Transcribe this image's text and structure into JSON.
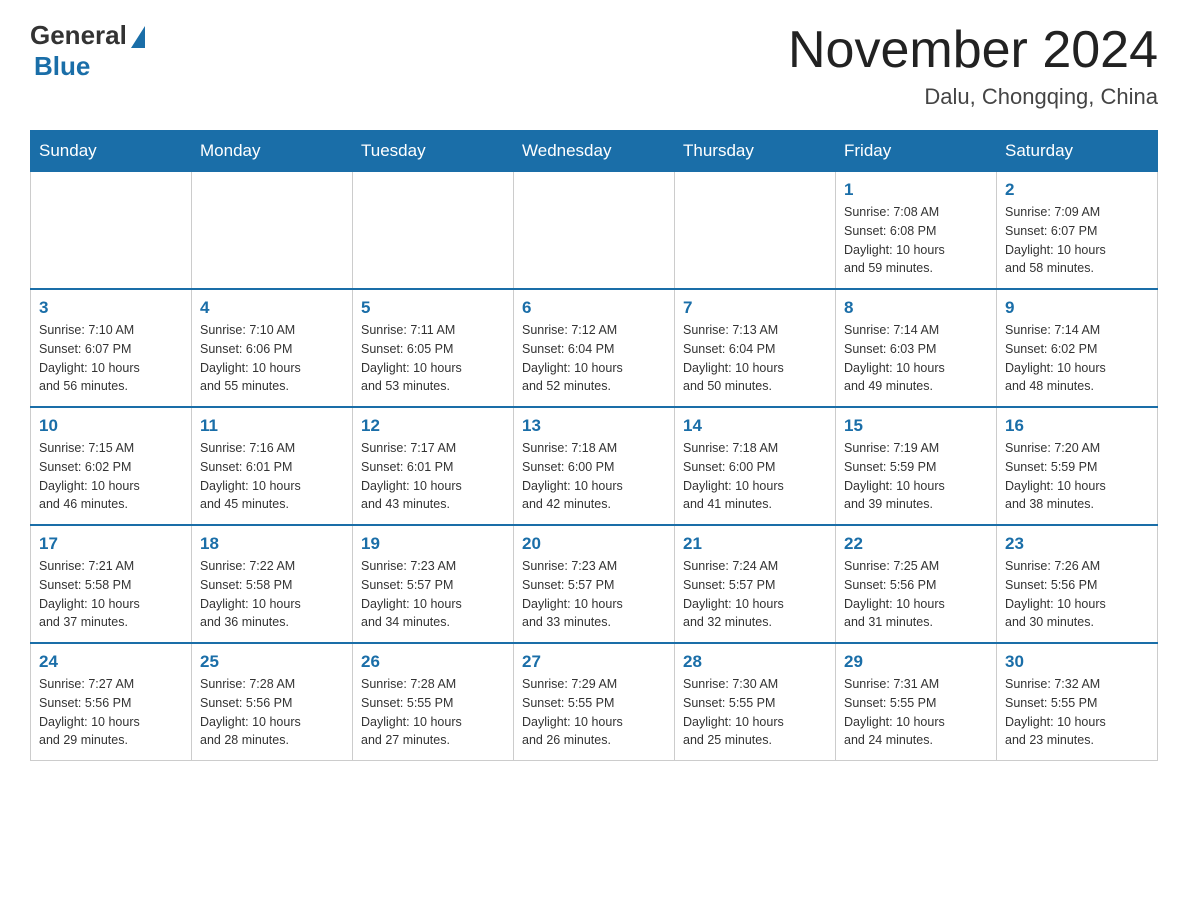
{
  "header": {
    "logo_general": "General",
    "logo_blue": "Blue",
    "month_title": "November 2024",
    "location": "Dalu, Chongqing, China"
  },
  "weekdays": [
    "Sunday",
    "Monday",
    "Tuesday",
    "Wednesday",
    "Thursday",
    "Friday",
    "Saturday"
  ],
  "weeks": [
    [
      {
        "day": "",
        "info": ""
      },
      {
        "day": "",
        "info": ""
      },
      {
        "day": "",
        "info": ""
      },
      {
        "day": "",
        "info": ""
      },
      {
        "day": "",
        "info": ""
      },
      {
        "day": "1",
        "info": "Sunrise: 7:08 AM\nSunset: 6:08 PM\nDaylight: 10 hours\nand 59 minutes."
      },
      {
        "day": "2",
        "info": "Sunrise: 7:09 AM\nSunset: 6:07 PM\nDaylight: 10 hours\nand 58 minutes."
      }
    ],
    [
      {
        "day": "3",
        "info": "Sunrise: 7:10 AM\nSunset: 6:07 PM\nDaylight: 10 hours\nand 56 minutes."
      },
      {
        "day": "4",
        "info": "Sunrise: 7:10 AM\nSunset: 6:06 PM\nDaylight: 10 hours\nand 55 minutes."
      },
      {
        "day": "5",
        "info": "Sunrise: 7:11 AM\nSunset: 6:05 PM\nDaylight: 10 hours\nand 53 minutes."
      },
      {
        "day": "6",
        "info": "Sunrise: 7:12 AM\nSunset: 6:04 PM\nDaylight: 10 hours\nand 52 minutes."
      },
      {
        "day": "7",
        "info": "Sunrise: 7:13 AM\nSunset: 6:04 PM\nDaylight: 10 hours\nand 50 minutes."
      },
      {
        "day": "8",
        "info": "Sunrise: 7:14 AM\nSunset: 6:03 PM\nDaylight: 10 hours\nand 49 minutes."
      },
      {
        "day": "9",
        "info": "Sunrise: 7:14 AM\nSunset: 6:02 PM\nDaylight: 10 hours\nand 48 minutes."
      }
    ],
    [
      {
        "day": "10",
        "info": "Sunrise: 7:15 AM\nSunset: 6:02 PM\nDaylight: 10 hours\nand 46 minutes."
      },
      {
        "day": "11",
        "info": "Sunrise: 7:16 AM\nSunset: 6:01 PM\nDaylight: 10 hours\nand 45 minutes."
      },
      {
        "day": "12",
        "info": "Sunrise: 7:17 AM\nSunset: 6:01 PM\nDaylight: 10 hours\nand 43 minutes."
      },
      {
        "day": "13",
        "info": "Sunrise: 7:18 AM\nSunset: 6:00 PM\nDaylight: 10 hours\nand 42 minutes."
      },
      {
        "day": "14",
        "info": "Sunrise: 7:18 AM\nSunset: 6:00 PM\nDaylight: 10 hours\nand 41 minutes."
      },
      {
        "day": "15",
        "info": "Sunrise: 7:19 AM\nSunset: 5:59 PM\nDaylight: 10 hours\nand 39 minutes."
      },
      {
        "day": "16",
        "info": "Sunrise: 7:20 AM\nSunset: 5:59 PM\nDaylight: 10 hours\nand 38 minutes."
      }
    ],
    [
      {
        "day": "17",
        "info": "Sunrise: 7:21 AM\nSunset: 5:58 PM\nDaylight: 10 hours\nand 37 minutes."
      },
      {
        "day": "18",
        "info": "Sunrise: 7:22 AM\nSunset: 5:58 PM\nDaylight: 10 hours\nand 36 minutes."
      },
      {
        "day": "19",
        "info": "Sunrise: 7:23 AM\nSunset: 5:57 PM\nDaylight: 10 hours\nand 34 minutes."
      },
      {
        "day": "20",
        "info": "Sunrise: 7:23 AM\nSunset: 5:57 PM\nDaylight: 10 hours\nand 33 minutes."
      },
      {
        "day": "21",
        "info": "Sunrise: 7:24 AM\nSunset: 5:57 PM\nDaylight: 10 hours\nand 32 minutes."
      },
      {
        "day": "22",
        "info": "Sunrise: 7:25 AM\nSunset: 5:56 PM\nDaylight: 10 hours\nand 31 minutes."
      },
      {
        "day": "23",
        "info": "Sunrise: 7:26 AM\nSunset: 5:56 PM\nDaylight: 10 hours\nand 30 minutes."
      }
    ],
    [
      {
        "day": "24",
        "info": "Sunrise: 7:27 AM\nSunset: 5:56 PM\nDaylight: 10 hours\nand 29 minutes."
      },
      {
        "day": "25",
        "info": "Sunrise: 7:28 AM\nSunset: 5:56 PM\nDaylight: 10 hours\nand 28 minutes."
      },
      {
        "day": "26",
        "info": "Sunrise: 7:28 AM\nSunset: 5:55 PM\nDaylight: 10 hours\nand 27 minutes."
      },
      {
        "day": "27",
        "info": "Sunrise: 7:29 AM\nSunset: 5:55 PM\nDaylight: 10 hours\nand 26 minutes."
      },
      {
        "day": "28",
        "info": "Sunrise: 7:30 AM\nSunset: 5:55 PM\nDaylight: 10 hours\nand 25 minutes."
      },
      {
        "day": "29",
        "info": "Sunrise: 7:31 AM\nSunset: 5:55 PM\nDaylight: 10 hours\nand 24 minutes."
      },
      {
        "day": "30",
        "info": "Sunrise: 7:32 AM\nSunset: 5:55 PM\nDaylight: 10 hours\nand 23 minutes."
      }
    ]
  ]
}
